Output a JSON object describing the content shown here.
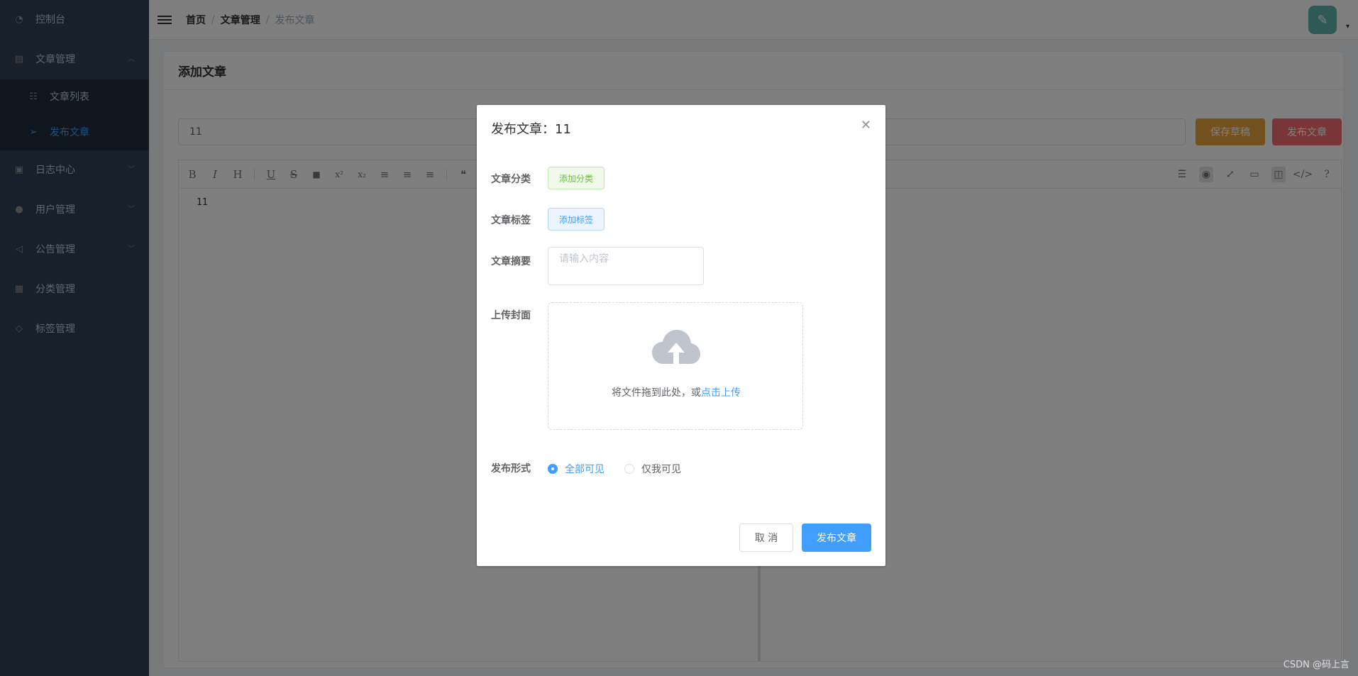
{
  "sidebar": {
    "items": [
      {
        "label": "控制台",
        "icon": "dashboard-icon"
      },
      {
        "label": "文章管理",
        "icon": "document-icon",
        "expanded": true,
        "children": [
          {
            "label": "文章列表",
            "icon": "list-icon"
          },
          {
            "label": "发布文章",
            "icon": "send-icon",
            "active": true
          }
        ]
      },
      {
        "label": "日志中心",
        "icon": "log-icon"
      },
      {
        "label": "用户管理",
        "icon": "user-icon"
      },
      {
        "label": "公告管理",
        "icon": "announcement-icon"
      },
      {
        "label": "分类管理",
        "icon": "category-icon"
      },
      {
        "label": "标签管理",
        "icon": "tag-icon"
      }
    ]
  },
  "breadcrumb": [
    "首页",
    "文章管理",
    "发布文章"
  ],
  "card": {
    "title": "添加文章",
    "title_value": "11",
    "save_draft_label": "保存草稿",
    "publish_label": "发布文章"
  },
  "editor": {
    "toolbar": [
      "B",
      "I",
      "H",
      "U",
      "S",
      "🔖",
      "x²",
      "x₂",
      "≡",
      "≡",
      "≡",
      "❝"
    ],
    "content": "11"
  },
  "dialog": {
    "title": "发布文章：11",
    "category_label": "文章分类",
    "category_button": "添加分类",
    "tag_label": "文章标签",
    "tag_button": "添加标签",
    "summary_label": "文章摘要",
    "summary_placeholder": "请输入内容",
    "cover_label": "上传封面",
    "upload_text": "将文件拖到此处，或",
    "upload_link": "点击上传",
    "visibility_label": "发布形式",
    "visibility_options": [
      "全部可见",
      "仅我可见"
    ],
    "visibility_selected": "全部可见",
    "cancel_label": "取 消",
    "confirm_label": "发布文章"
  },
  "watermark": "CSDN @码上言",
  "colors": {
    "sidebar_bg": "#304156",
    "primary": "#409eff",
    "warning": "#e6a23c",
    "danger": "#f56c6c"
  }
}
